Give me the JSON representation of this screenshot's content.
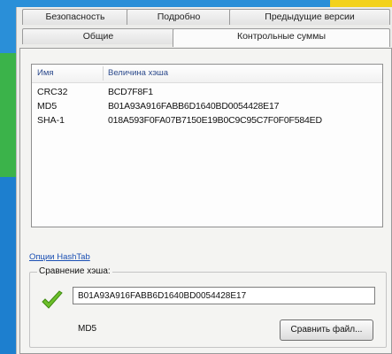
{
  "tabs": {
    "row1": [
      "Безопасность",
      "Подробно",
      "Предыдущие версии"
    ],
    "row2": [
      "Общие",
      "Контрольные суммы"
    ]
  },
  "hash_list": {
    "col_name": "Имя",
    "col_hash": "Величина хэша",
    "rows": [
      {
        "name": "CRC32",
        "hash": "BCD7F8F1"
      },
      {
        "name": "MD5",
        "hash": "B01A93A916FABB6D1640BD0054428E17"
      },
      {
        "name": "SHA-1",
        "hash": "018A593F0FA07B7150E19B0C9C95C7F0F0F584ED"
      }
    ]
  },
  "options_link": "Опции HashTab",
  "compare": {
    "title": "Сравнение хэша:",
    "value": "B01A93A916FABB6D1640BD0054428E17",
    "algorithm": "MD5",
    "button": "Сравнить файл..."
  },
  "colors": {
    "check": "#6cbf2a",
    "link": "#1a4fb3"
  }
}
